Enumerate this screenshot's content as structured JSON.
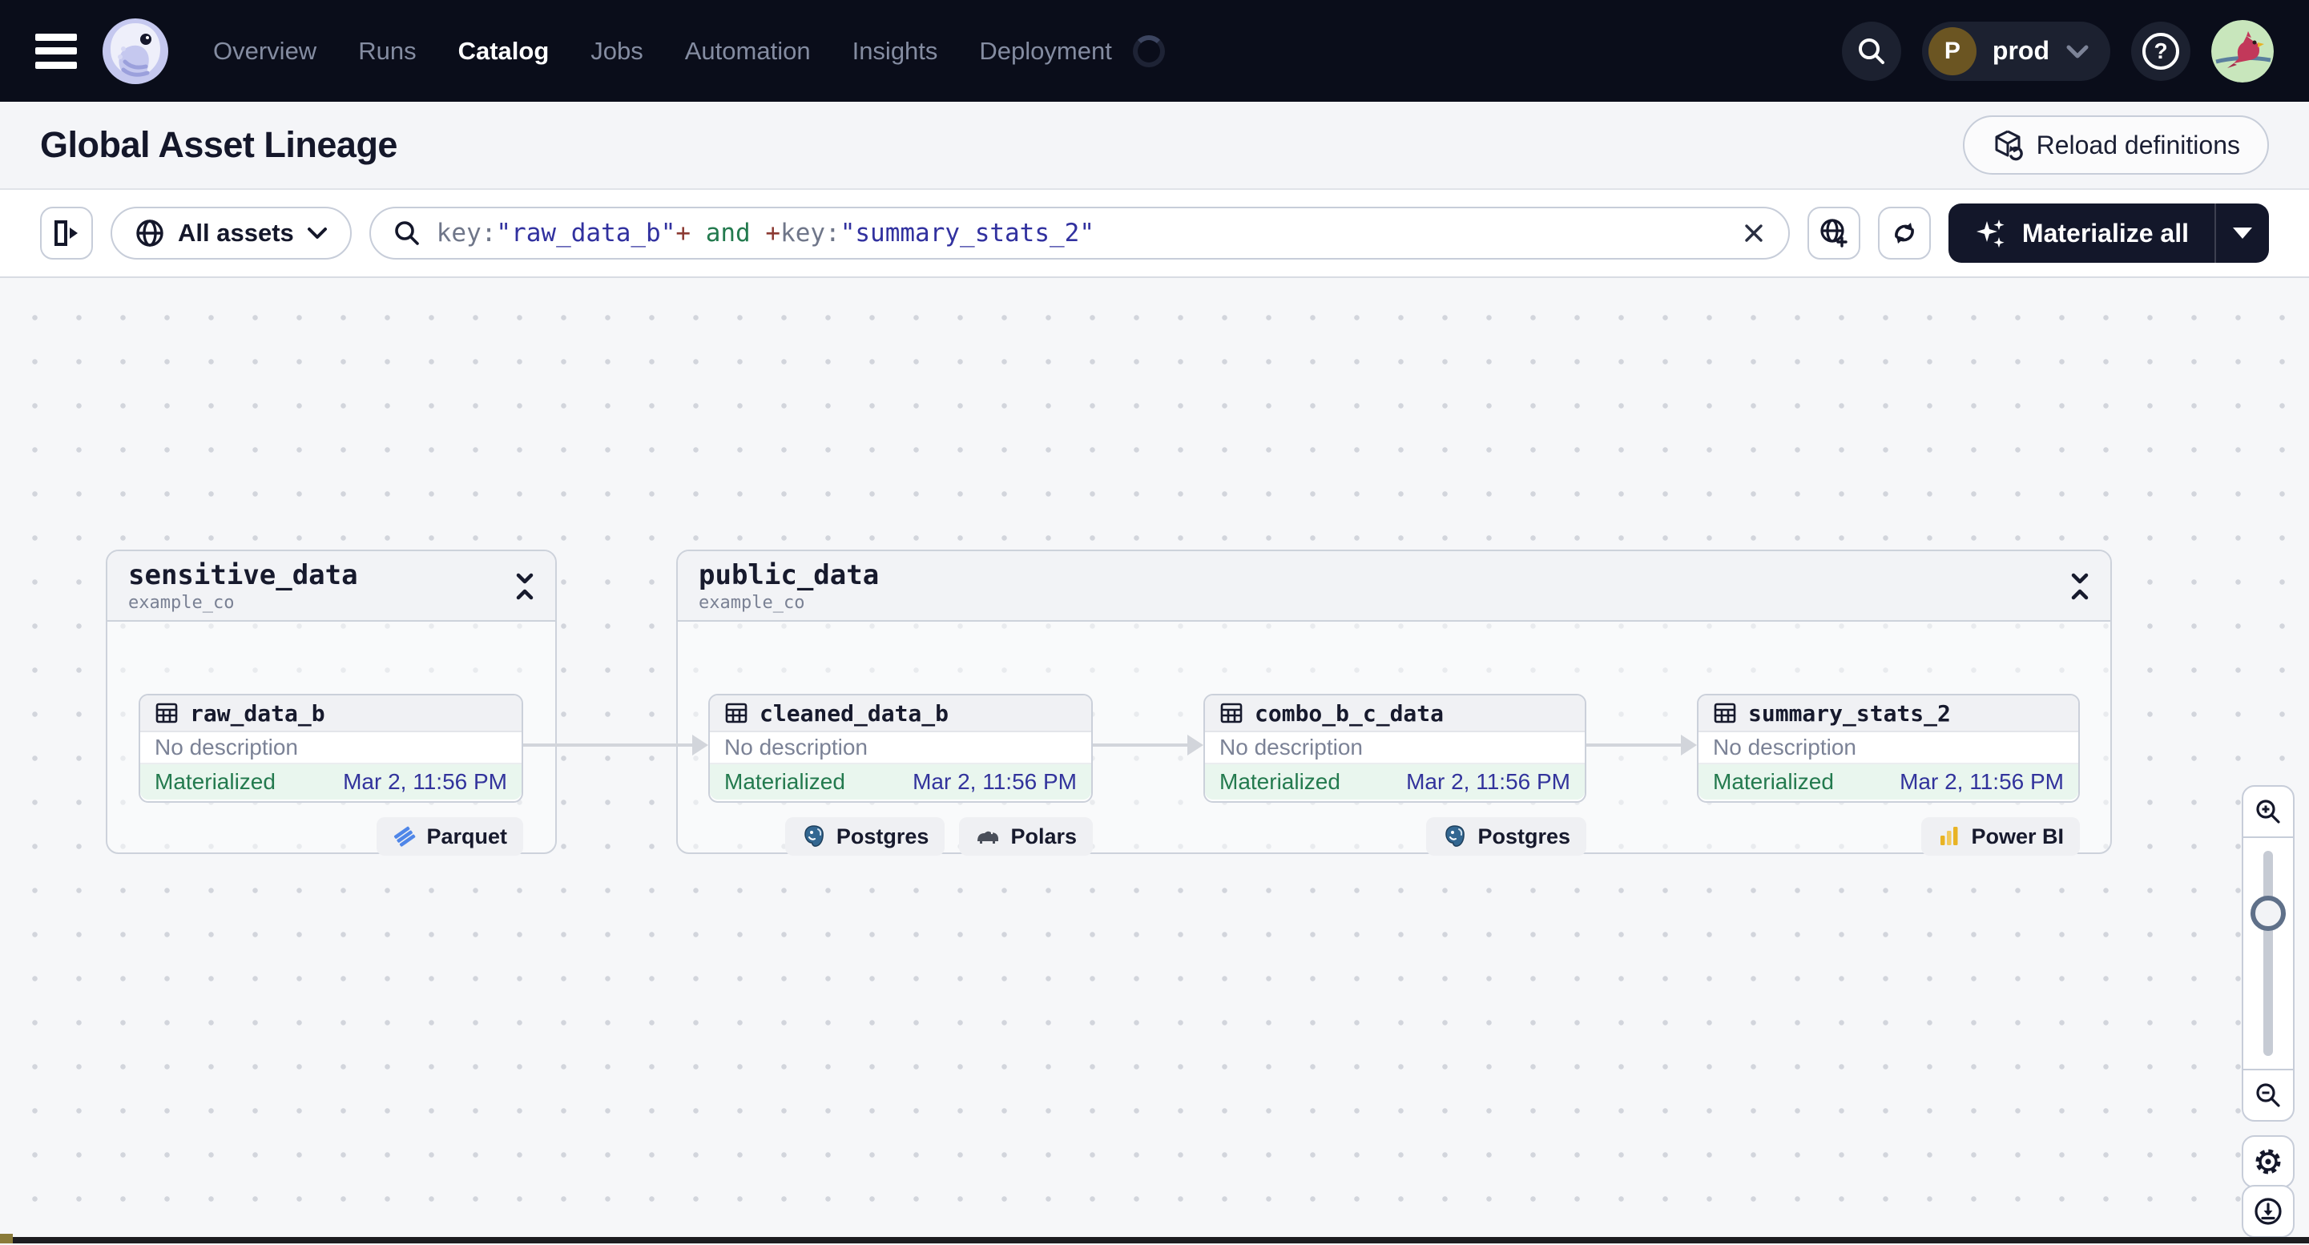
{
  "nav": {
    "items": [
      {
        "label": "Overview",
        "active": false
      },
      {
        "label": "Runs",
        "active": false
      },
      {
        "label": "Catalog",
        "active": true
      },
      {
        "label": "Jobs",
        "active": false
      },
      {
        "label": "Automation",
        "active": false
      },
      {
        "label": "Insights",
        "active": false
      },
      {
        "label": "Deployment",
        "active": false
      }
    ],
    "env_badge": {
      "initial": "P",
      "label": "prod"
    },
    "help_glyph": "?"
  },
  "header": {
    "title": "Global Asset Lineage",
    "reload_label": "Reload definitions"
  },
  "toolbar": {
    "scope_label": "All assets",
    "query": {
      "segments": [
        {
          "text": "key:",
          "kind": "key"
        },
        {
          "text": "\"raw_data_b\"",
          "kind": "string"
        },
        {
          "text": "+",
          "kind": "op"
        },
        {
          "text": " and ",
          "kind": "and"
        },
        {
          "text": "+",
          "kind": "op"
        },
        {
          "text": "key:",
          "kind": "key"
        },
        {
          "text": "\"summary_stats_2\"",
          "kind": "string"
        }
      ]
    },
    "materialize_label": "Materialize all"
  },
  "graph": {
    "groups": [
      {
        "name": "sensitive_data",
        "repo": "example_co"
      },
      {
        "name": "public_data",
        "repo": "example_co"
      }
    ],
    "nodes": [
      {
        "name": "raw_data_b",
        "description": "No description",
        "status": "Materialized",
        "timestamp": "Mar 2, 11:56 PM",
        "tags": [
          {
            "label": "Parquet",
            "icon": "parquet-icon"
          }
        ]
      },
      {
        "name": "cleaned_data_b",
        "description": "No description",
        "status": "Materialized",
        "timestamp": "Mar 2, 11:56 PM",
        "tags": [
          {
            "label": "Postgres",
            "icon": "postgres-icon"
          },
          {
            "label": "Polars",
            "icon": "polars-icon"
          }
        ]
      },
      {
        "name": "combo_b_c_data",
        "description": "No description",
        "status": "Materialized",
        "timestamp": "Mar 2, 11:56 PM",
        "tags": [
          {
            "label": "Postgres",
            "icon": "postgres-icon"
          }
        ]
      },
      {
        "name": "summary_stats_2",
        "description": "No description",
        "status": "Materialized",
        "timestamp": "Mar 2, 11:56 PM",
        "tags": [
          {
            "label": "Power BI",
            "icon": "powerbi-icon"
          }
        ]
      }
    ]
  },
  "colors": {
    "navbar_bg": "#0A0D1A",
    "accent_dark": "#13172A",
    "status_green": "#237A4E",
    "status_bg": "#E9F6EE",
    "timestamp_blue": "#32339C",
    "query_string": "#31319F",
    "query_operator": "#8C3A32",
    "query_and": "#237A4E",
    "edge_gray": "#D2D5DB",
    "postgres_blue": "#336791",
    "powerbi_yellow": "#E8B324",
    "parquet_blue": "#4F86E8"
  }
}
